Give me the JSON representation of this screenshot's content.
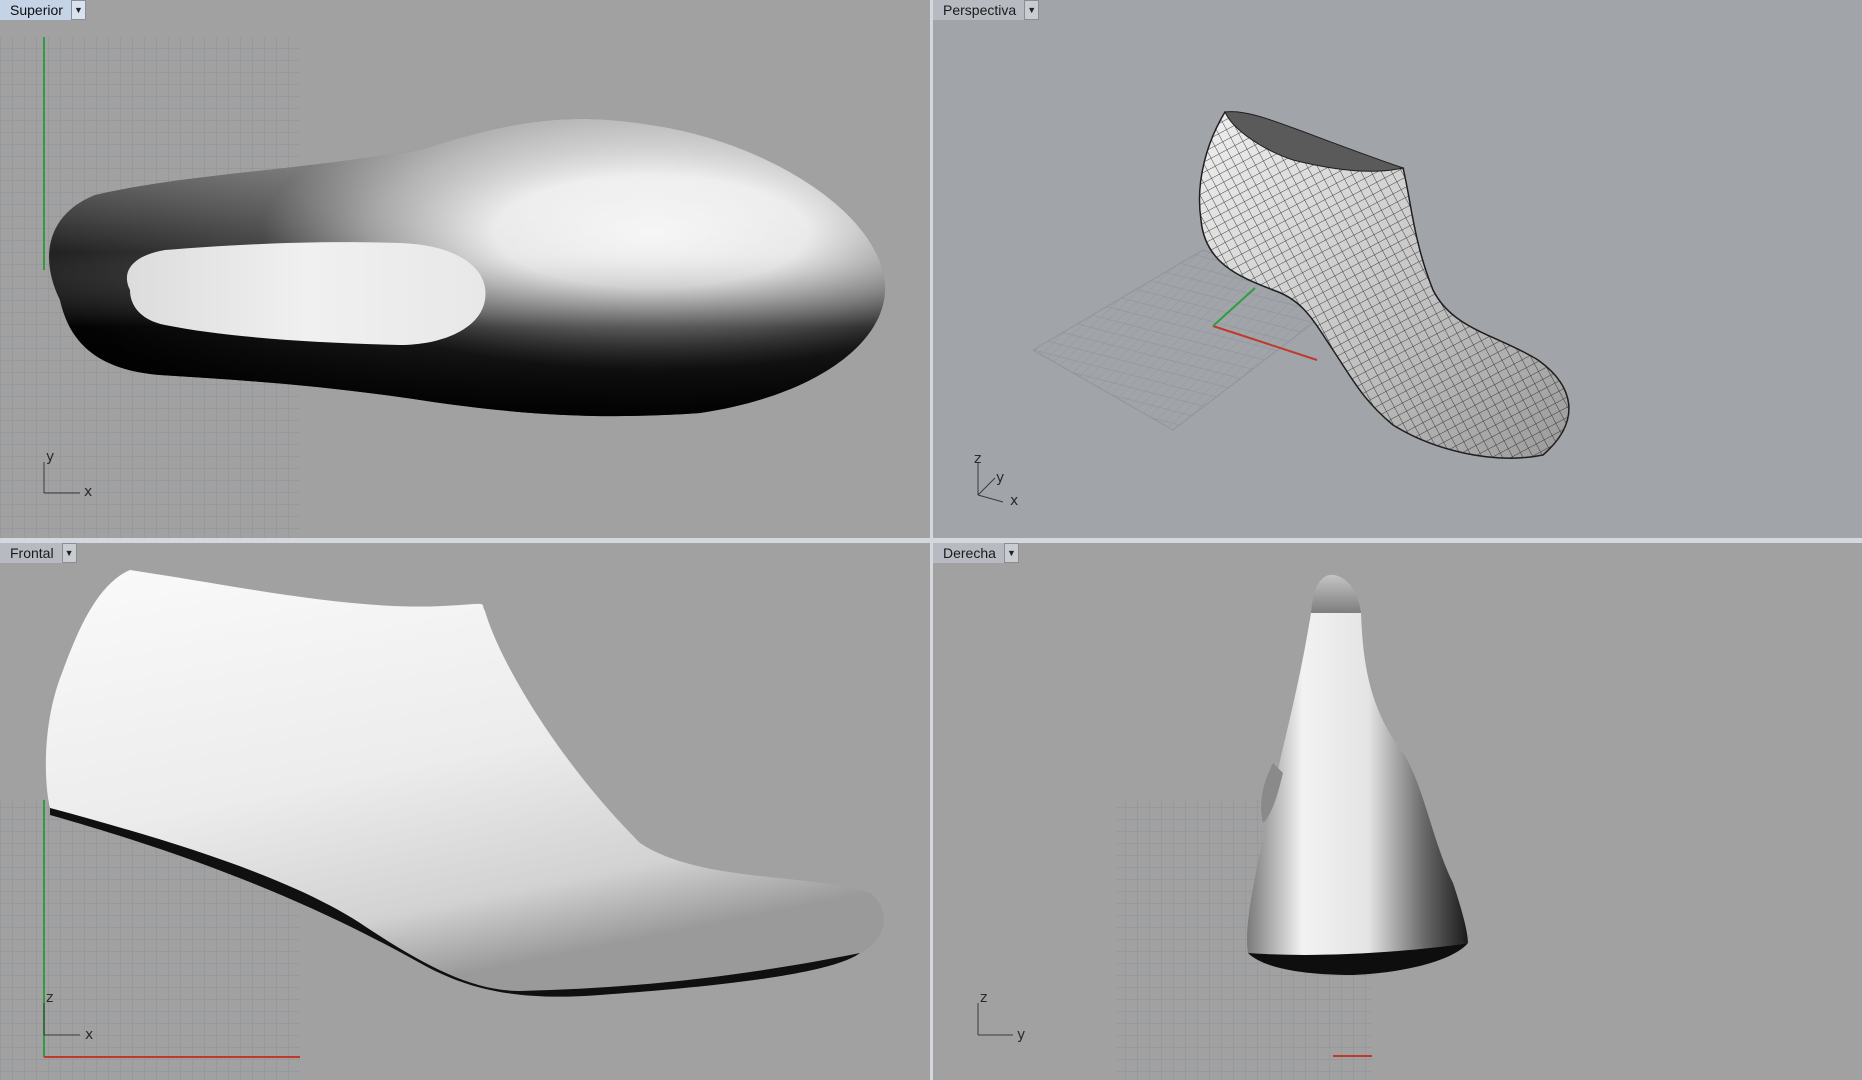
{
  "viewports": [
    {
      "id": "superior",
      "label": "Superior",
      "active": true,
      "axes": [
        "y",
        "x"
      ]
    },
    {
      "id": "perspectiva",
      "label": "Perspectiva",
      "active": false,
      "axes": [
        "z",
        "y",
        "x"
      ]
    },
    {
      "id": "frontal",
      "label": "Frontal",
      "active": false,
      "axes": [
        "z",
        "x"
      ]
    },
    {
      "id": "derecha",
      "label": "Derecha",
      "active": false,
      "axes": [
        "z",
        "y"
      ]
    }
  ],
  "icons": {
    "dropdown": "triangle-down-icon"
  },
  "colors": {
    "viewport_bg": "#a1a1a1",
    "grid_line": "#8e96a0",
    "x_axis": "#c0392b",
    "y_axis": "#2e9e3e",
    "active_title": "#c5d3e6"
  }
}
